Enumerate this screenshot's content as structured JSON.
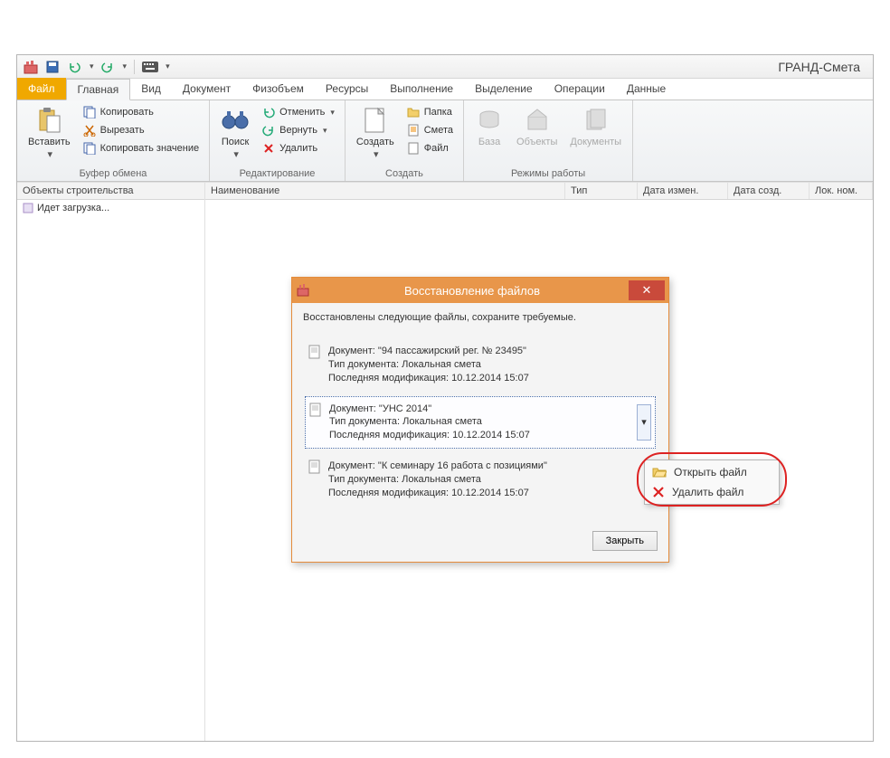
{
  "app_title": "ГРАНД-Смета",
  "qat": {
    "items": [
      "app",
      "save",
      "undo",
      "redo",
      "keyboard"
    ]
  },
  "ribbon": {
    "file_tab": "Файл",
    "tabs": [
      "Главная",
      "Вид",
      "Документ",
      "Физобъем",
      "Ресурсы",
      "Выполнение",
      "Выделение",
      "Операции",
      "Данные"
    ],
    "active_tab": 0,
    "groups": {
      "clipboard": {
        "label": "Буфер обмена",
        "paste": "Вставить",
        "copy": "Копировать",
        "cut": "Вырезать",
        "copy_value": "Копировать значение"
      },
      "editing": {
        "label": "Редактирование",
        "search": "Поиск",
        "undo": "Отменить",
        "redo": "Вернуть",
        "delete": "Удалить"
      },
      "create": {
        "label": "Создать",
        "create": "Создать",
        "folder": "Папка",
        "estimate": "Смета",
        "file": "Файл"
      },
      "modes": {
        "label": "Режимы работы",
        "base": "База",
        "objects": "Объекты",
        "documents": "Документы"
      }
    }
  },
  "left_pane": {
    "header": "Объекты строительства",
    "item": "Идет загрузка..."
  },
  "columns": {
    "name": "Наименование",
    "type": "Тип",
    "modified": "Дата измен.",
    "created": "Дата созд.",
    "loc": "Лок. ном."
  },
  "dialog": {
    "title": "Восстановление файлов",
    "message": "Восстановлены следующие файлы, сохраните требуемые.",
    "doc_label": "Документ:",
    "type_label": "Тип документа:",
    "mod_label": "Последняя модификация:",
    "items": [
      {
        "name": "\"94 пассажирский рег. № 23495\"",
        "type": "Локальная смета",
        "modified": "10.12.2014 15:07",
        "selected": false
      },
      {
        "name": "\"УНС 2014\"",
        "type": "Локальная смета",
        "modified": "10.12.2014 15:07",
        "selected": true
      },
      {
        "name": "\"К семинару 16 работа с позициями\"",
        "type": "Локальная смета",
        "modified": "10.12.2014 15:07",
        "selected": false
      }
    ],
    "close_btn": "Закрыть"
  },
  "context_menu": {
    "open": "Открыть файл",
    "delete": "Удалить файл"
  }
}
